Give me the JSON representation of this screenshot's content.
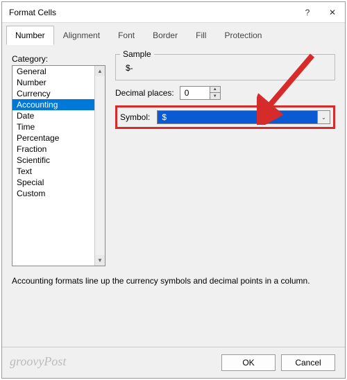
{
  "window": {
    "title": "Format Cells",
    "help": "?",
    "close": "✕"
  },
  "tabs": [
    "Number",
    "Alignment",
    "Font",
    "Border",
    "Fill",
    "Protection"
  ],
  "activeTab": 0,
  "category": {
    "label": "Category:",
    "items": [
      "General",
      "Number",
      "Currency",
      "Accounting",
      "Date",
      "Time",
      "Percentage",
      "Fraction",
      "Scientific",
      "Text",
      "Special",
      "Custom"
    ],
    "selected": "Accounting"
  },
  "sample": {
    "label": "Sample",
    "value": "$-"
  },
  "decimal": {
    "label": "Decimal places:",
    "value": "0"
  },
  "symbol": {
    "label": "Symbol:",
    "value": "$"
  },
  "description": "Accounting formats line up the currency symbols and decimal points in a column.",
  "buttons": {
    "ok": "OK",
    "cancel": "Cancel"
  },
  "watermark": "groovyPost"
}
